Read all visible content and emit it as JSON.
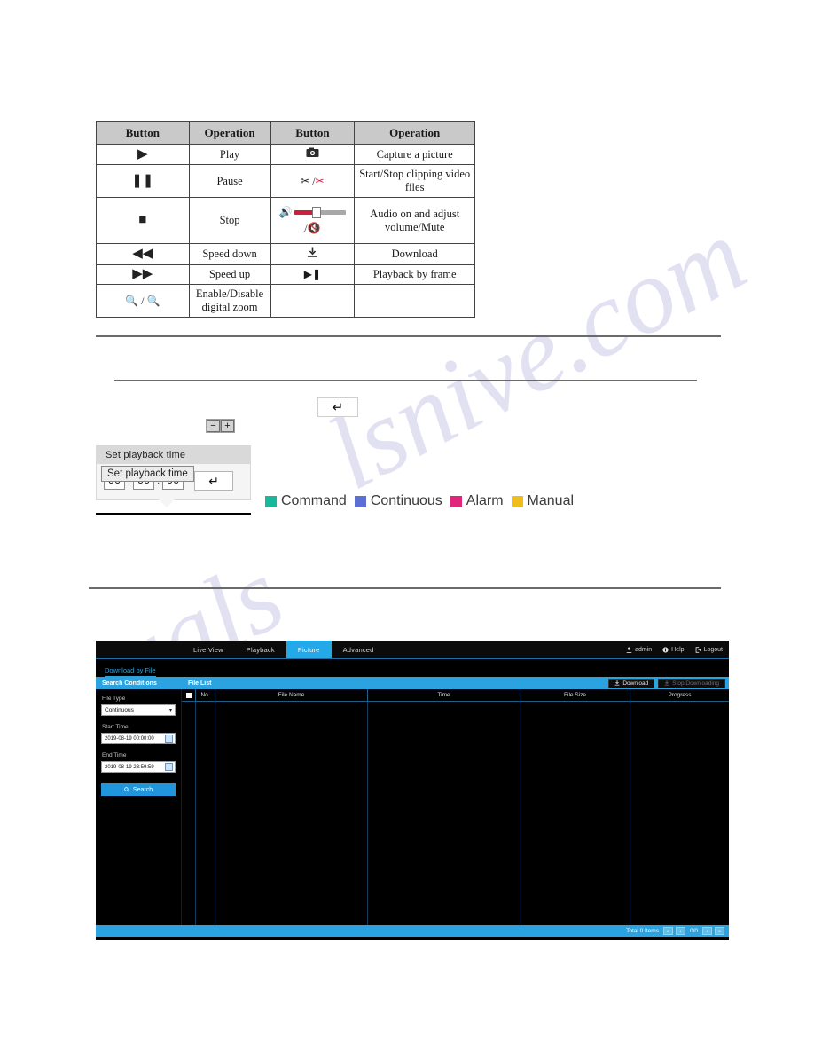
{
  "button_table": {
    "headers": [
      "Button",
      "Operation",
      "Button",
      "Operation"
    ],
    "rows": [
      {
        "icon_left": "play-icon",
        "op_left": "Play",
        "icon_right": "camera-icon",
        "op_right": "Capture a picture"
      },
      {
        "icon_left": "pause-icon",
        "op_left": "Pause",
        "icon_right": "scissors-icon",
        "op_right": "Start/Stop clipping video files"
      },
      {
        "icon_left": "stop-icon",
        "op_left": "Stop",
        "icon_right": "volume-slider",
        "op_right": "Audio on and adjust volume/Mute"
      },
      {
        "icon_left": "rewind-icon",
        "op_left": "Speed down",
        "icon_right": "download-icon",
        "op_right": "Download"
      },
      {
        "icon_left": "fast-forward-icon",
        "op_left": "Speed up",
        "icon_right": "frame-advance-icon",
        "op_right": "Playback by frame"
      },
      {
        "icon_left": "zoom-icon",
        "op_left": "Enable/Disable digital zoom",
        "icon_right": "",
        "op_right": ""
      }
    ]
  },
  "playback_time": {
    "title": "Set playback time",
    "tooltip": "Set playback time",
    "hours": "00",
    "minutes": "00",
    "seconds": "00",
    "separator": ":",
    "enter_label": "↵"
  },
  "enter_button": {
    "label": "↵"
  },
  "stepper": {
    "minus": "−",
    "plus": "+"
  },
  "legend": {
    "items": [
      {
        "label": "Command",
        "color": "#19b89b"
      },
      {
        "label": "Continuous",
        "color": "#5b6fd4"
      },
      {
        "label": "Alarm",
        "color": "#e0267a"
      },
      {
        "label": "Manual",
        "color": "#eebe1c"
      }
    ]
  },
  "app": {
    "tabs": [
      {
        "label": "Live View",
        "active": false
      },
      {
        "label": "Playback",
        "active": false
      },
      {
        "label": "Picture",
        "active": true
      },
      {
        "label": "Advanced",
        "active": false
      }
    ],
    "user": {
      "account": "admin",
      "help": "Help",
      "logout": "Logout"
    },
    "sub_nav": {
      "download_by_file": "Download by File"
    },
    "bands": {
      "search_conditions": "Search Conditions",
      "file_list": "File List",
      "download_button": "Download",
      "stop_download_button": "Stop Downloading"
    },
    "search": {
      "file_type_label": "File Type",
      "file_type_value": "Continuous",
      "start_time_label": "Start Time",
      "start_time_value": "2019-08-19 00:00:00",
      "end_time_label": "End Time",
      "end_time_value": "2019-08-19 23:59:59",
      "search_button": "Search"
    },
    "table": {
      "columns": [
        "No.",
        "File Name",
        "Time",
        "File Size",
        "Progress"
      ],
      "rows": []
    },
    "footer": {
      "total_text": "Total 0 Items",
      "page_text": "0/0",
      "first": "«",
      "prev": "‹",
      "next": "›",
      "last": "»"
    }
  },
  "watermark": {
    "text1": "lsnive.com",
    "text2": "uals"
  }
}
